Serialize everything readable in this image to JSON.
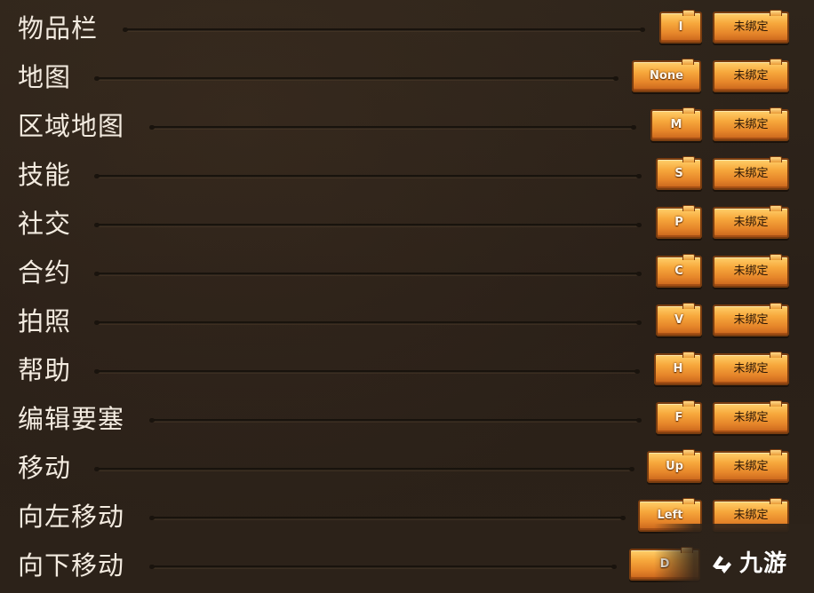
{
  "rows": [
    {
      "label": "物品栏",
      "key": "I",
      "binding": "未绑定"
    },
    {
      "label": "地图",
      "key": "None",
      "binding": "未绑定"
    },
    {
      "label": "区域地图",
      "key": "M",
      "binding": "未绑定"
    },
    {
      "label": "技能",
      "key": "S",
      "binding": "未绑定"
    },
    {
      "label": "社交",
      "key": "P",
      "binding": "未绑定"
    },
    {
      "label": "合约",
      "key": "C",
      "binding": "未绑定"
    },
    {
      "label": "拍照",
      "key": "V",
      "binding": "未绑定"
    },
    {
      "label": "帮助",
      "key": "H",
      "binding": "未绑定"
    },
    {
      "label": "编辑要塞",
      "key": "F",
      "binding": "未绑定"
    },
    {
      "label": "移动",
      "key": "Up",
      "binding": "未绑定"
    },
    {
      "label": "向左移动",
      "key": "Left",
      "binding": "未绑定"
    },
    {
      "label": "向下移动",
      "key": "D",
      "binding": ""
    }
  ],
  "watermark": {
    "text": "九游"
  },
  "colors": {
    "background": "#2d231a",
    "button_gold": "#f7a83c",
    "button_border": "#7a3d10",
    "label_text": "#f3ebe0"
  }
}
